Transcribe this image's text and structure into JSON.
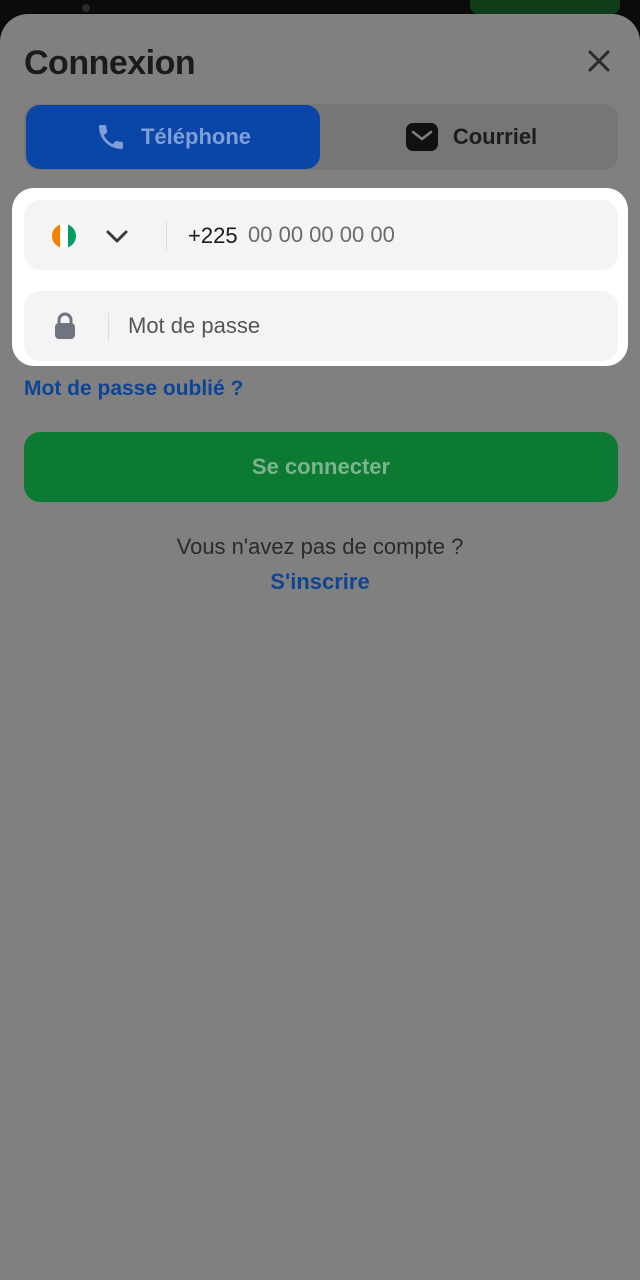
{
  "header": {
    "title": "Connexion",
    "close_icon": "close-icon"
  },
  "tabs": [
    {
      "label": "Téléphone",
      "icon": "phone-icon",
      "active": true
    },
    {
      "label": "Courriel",
      "icon": "mail-icon",
      "active": false
    }
  ],
  "phone_field": {
    "country_flag": "cote-divoire-flag-icon",
    "flag_colors": [
      "#f77f00",
      "#ffffff",
      "#009e60"
    ],
    "dropdown_icon": "chevron-down-icon",
    "prefix": "+225",
    "value": "",
    "placeholder": "00 00 00 00 00"
  },
  "password_field": {
    "icon": "lock-icon",
    "value": "",
    "placeholder": "Mot de passe"
  },
  "forgot_password_label": "Mot de passe oublié ?",
  "login_button_label": "Se connecter",
  "no_account_text": "Vous n'avez pas de compte ?",
  "signup_label": "S'inscrire",
  "colors": {
    "overlay": "#808080",
    "primary_blue": "#0a45a8",
    "link_blue": "#0e4494",
    "primary_green": "#0c7a32",
    "highlight": "#ffffff"
  }
}
